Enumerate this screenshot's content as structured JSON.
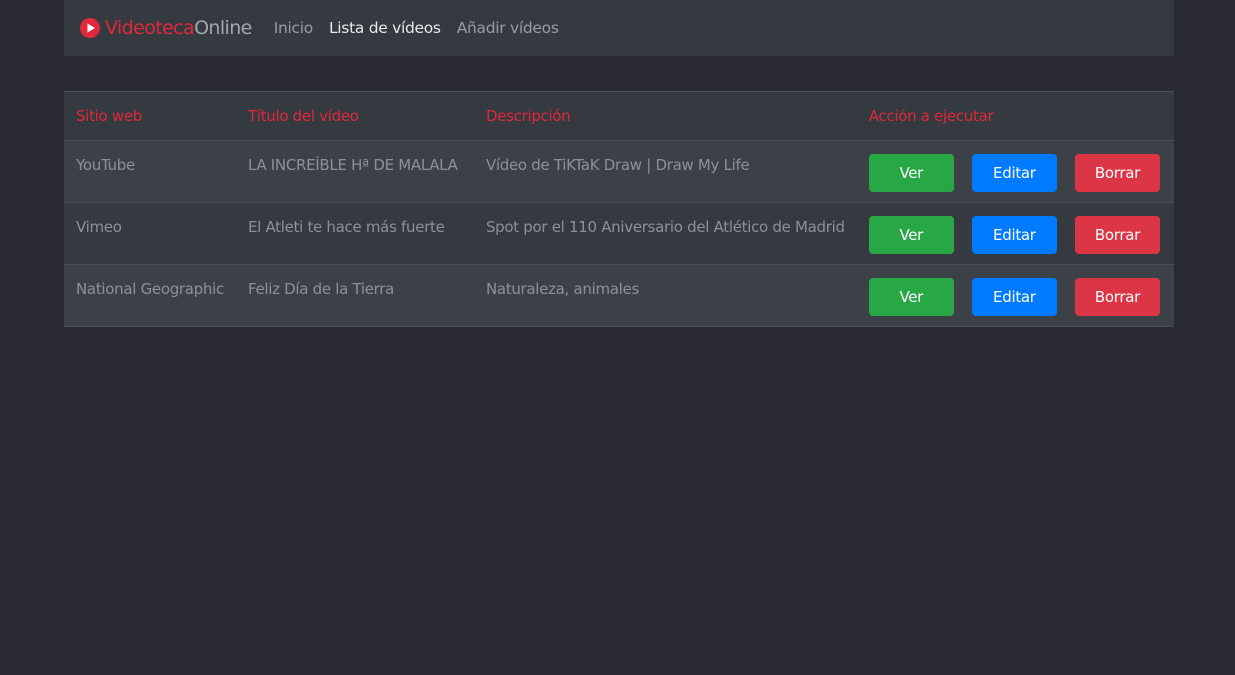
{
  "navbar": {
    "brand_part1": "Videoteca",
    "brand_part2": "Online",
    "links": [
      "Inicio",
      "Lista de vídeos",
      "Añadir vídeos"
    ]
  },
  "table": {
    "headers": [
      "Sitio web",
      "Título del vídeo",
      "Descripción",
      "Acción a ejecutar"
    ],
    "rows": [
      {
        "site": "YouTube",
        "title": "LA INCREÍBLE Hª DE MALALA",
        "description": "Vídeo de TiKTaK Draw | Draw My Life"
      },
      {
        "site": "Vimeo",
        "title": "El Atleti te hace más fuerte",
        "description": "Spot por el 110 Aniversario del Atlético de Madrid"
      },
      {
        "site": "National Geographic",
        "title": "Feliz Día de la Tierra",
        "description": "Naturaleza, animales"
      }
    ],
    "actions": {
      "view": "Ver",
      "edit": "Editar",
      "delete": "Borrar"
    }
  },
  "colors": {
    "accent": "#e0283a",
    "view": "#28a745",
    "edit": "#007bff",
    "delete": "#dc3545"
  },
  "icons": {
    "brand": "play-circle-icon"
  }
}
